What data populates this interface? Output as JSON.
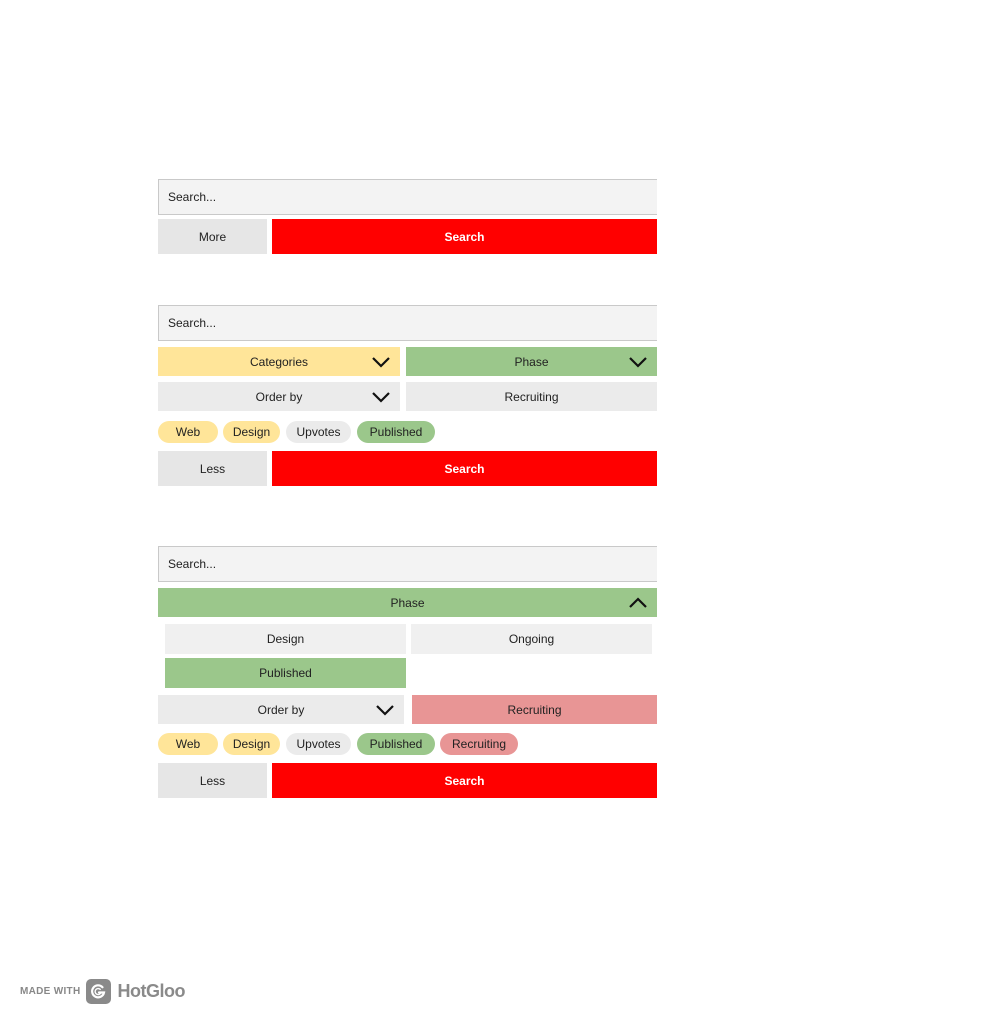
{
  "panel1": {
    "search_placeholder": "Search...",
    "more_label": "More",
    "search_label": "Search"
  },
  "panel2": {
    "search_placeholder": "Search...",
    "categories_label": "Categories",
    "phase_label": "Phase",
    "order_label": "Order by",
    "recruiting_label": "Recruiting",
    "tags": [
      "Web",
      "Design",
      "Upvotes",
      "Published"
    ],
    "less_label": "Less",
    "search_label": "Search"
  },
  "panel3": {
    "search_placeholder": "Search...",
    "phase_label": "Phase",
    "phase_options": [
      "Design",
      "Ongoing",
      "Published"
    ],
    "order_label": "Order by",
    "recruiting_label": "Recruiting",
    "tags": [
      "Web",
      "Design",
      "Upvotes",
      "Published",
      "Recruiting"
    ],
    "less_label": "Less",
    "search_label": "Search"
  },
  "footer": {
    "made_with": "MADE WITH",
    "brand": "HotGloo"
  },
  "colors": {
    "search_red": "#ff0000",
    "yellow": "#ffe599",
    "green": "#9bc78b",
    "gray": "#e6e6e6",
    "red_tag": "#e89595"
  },
  "icons": [
    "chevron-down-icon",
    "chevron-up-icon",
    "hotgloo-logo-icon"
  ]
}
